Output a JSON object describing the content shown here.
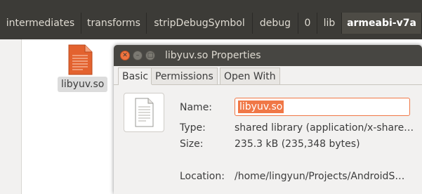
{
  "pathbar": {
    "crumbs": [
      "intermediates",
      "transforms",
      "stripDebugSymbol",
      "debug",
      "0",
      "lib",
      "armeabi-v7a"
    ]
  },
  "desktop_file": {
    "label": "libyuv.so",
    "icon": "shared-library-file-icon",
    "icon_color": "#e3622f"
  },
  "dialog": {
    "title": "libyuv.so Properties",
    "tabs": [
      "Basic",
      "Permissions",
      "Open With"
    ],
    "fields": {
      "name_label": "Name:",
      "name_value": "libyuv.so",
      "type_label": "Type:",
      "type_value": "shared library (application/x-share…",
      "size_label": "Size:",
      "size_value": "235.3 kB (235,348 bytes)",
      "location_label": "Location:",
      "location_value": "/home/lingyun/Projects/AndroidS…"
    },
    "accent": "#f07746"
  }
}
